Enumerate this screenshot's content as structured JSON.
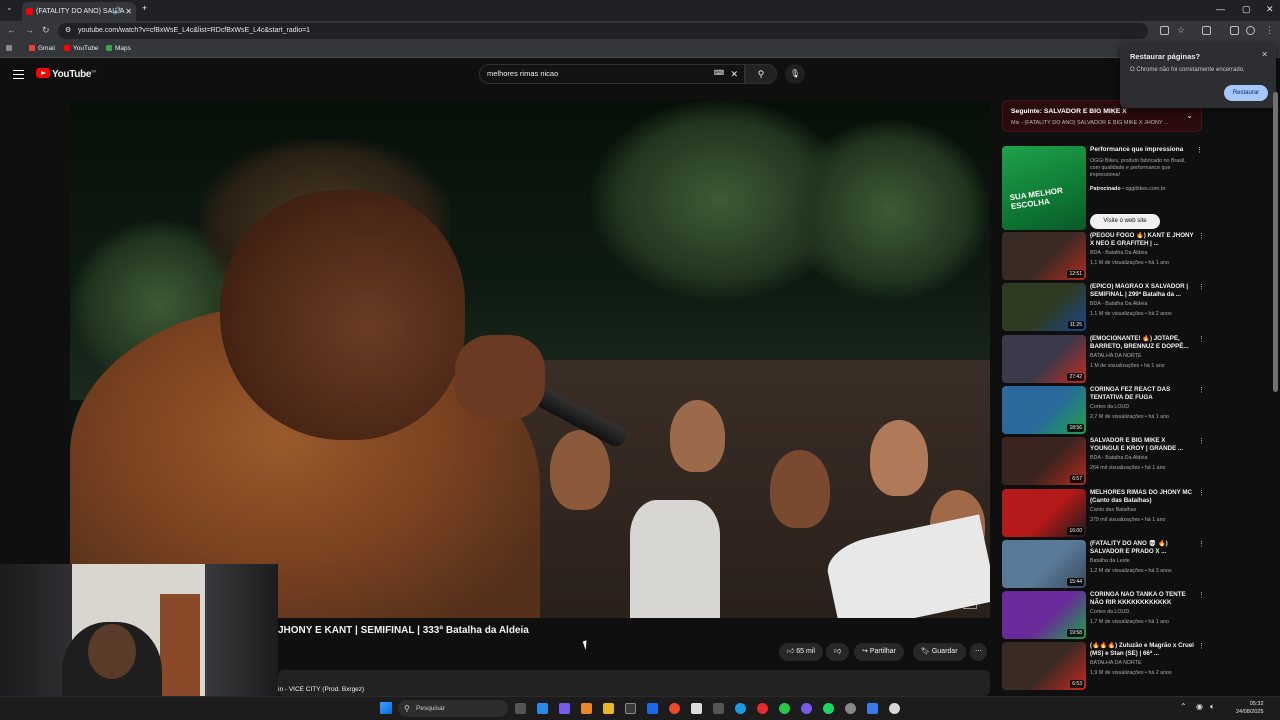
{
  "browser": {
    "tab_title": "(FATALITY DO ANO) SALVA",
    "url": "youtube.com/watch?v=cfBxWsE_L4c&list=RDcfBxWsE_L4c&start_radio=1",
    "bookmarks": [
      "Gmail",
      "YouTube",
      "Maps"
    ]
  },
  "youtube": {
    "logo": "YouTube",
    "logo_region": "BR",
    "search_value": "melhores rimas nicao"
  },
  "video": {
    "title": "JHONY E KANT | SEMIFINAL | 333ª Batalha da Aldeia",
    "likes": "65 mil",
    "share_label": "Partilhar",
    "save_label": "Guardar",
    "description_snippet": "in - VICE CITY (Prod. Bxrgez)"
  },
  "playlist": {
    "next_label": "Seguinte: SALVADOR E BIG MIKE X",
    "subtitle": "Mix - (FATALITY DO ANO) SALVADOR E BIG MIKE X JHONY ..."
  },
  "ad": {
    "title": "Performance que impressiona",
    "description": "OGGi Bikes, produto fabricado no Brasil, com qualidade e performance que impressiona!",
    "sponsored": "Patrocinado",
    "domain": "oggibikes.com.br",
    "thumb_text": "SUA MELHOR ESCOLHA",
    "cta": "Visite o web site"
  },
  "recommendations": [
    {
      "title": "(PEGOU FOGO 🔥) KANT E JHONY X NEO E GRAFITEH | ...",
      "channel": "BDA - Batalha Da Aldeia",
      "meta": "1,1 M de visualizações • há 1 ano",
      "duration": "12:51",
      "c1": "#3a2a24",
      "c2": "#b52a1c"
    },
    {
      "title": "(ÉPICO) MAGRÃO X SALVADOR | SEMIFINAL | 299ª Batalha da ...",
      "channel": "BDA - Batalha Da Aldeia",
      "meta": "1,1 M de visualizações • há 2 anos",
      "duration": "11:25",
      "c1": "#2e3a22",
      "c2": "#1a4a8a"
    },
    {
      "title": "(EMOCIONANTE! 🔥) JOTAPÊ, BARRETO, BRENNUZ E DOPPÊ...",
      "channel": "BATALHA DA NORTE",
      "meta": "1 M de visualizações • há 1 ano",
      "duration": "27:42",
      "c1": "#3a3a4a",
      "c2": "#c8281e"
    },
    {
      "title": "CORINGA FEZ REACT DAS TENTATIVA DE FUGA",
      "channel": "Cortes da LOUD",
      "meta": "2,7 M de visualizações • há 1 ano",
      "duration": "18:56",
      "c1": "#2a6a9a",
      "c2": "#1ea24a"
    },
    {
      "title": "SALVADOR E BIG MIKE X YOUNGUI E KROY | GRANDE ...",
      "channel": "BDA - Batalha Da Aldeia",
      "meta": "264 mil visualizações • há 1 ano",
      "duration": "6:57",
      "c1": "#3a2420",
      "c2": "#b52a1c"
    },
    {
      "title": "MELHORES RIMAS DO JHONY MC (Canto das Batalhas)",
      "channel": "Canto das Batalhas",
      "meta": "379 mil visualizações • há 1 ano",
      "duration": "16:00",
      "c1": "#b51a1a",
      "c2": "#1a1a1a"
    },
    {
      "title": "(FATALITY DO ANO 💀 🔥) SALVADOR E PRADO X ...",
      "channel": "Batalha da Leste",
      "meta": "1,2 M de visualizações • há 3 anos",
      "duration": "15:44",
      "c1": "#5a7a9a",
      "c2": "#3a4a5a"
    },
    {
      "title": "CORINGA NÃO TANKA O TENTE NÃO RIR KKKKKKKKKKKK",
      "channel": "Cortes da LOUD",
      "meta": "1,7 M de visualizações • há 1 ano",
      "duration": "19:58",
      "c1": "#6a2a9a",
      "c2": "#1ea24a"
    },
    {
      "title": "(🔥🔥🔥) Zuluzão e Magrão x Cruel (MS) e Stan (SE) | 66ª ...",
      "channel": "BATALHA DA NORTE",
      "meta": "1,9 M de visualizações • há 2 anos",
      "duration": "6:53",
      "c1": "#3a2a24",
      "c2": "#c8281e"
    }
  ],
  "restore_popup": {
    "title": "Restaurar páginas?",
    "message": "O Chrome não foi corretamente encerrado.",
    "button": "Restaurar"
  },
  "taskbar": {
    "search_placeholder": "Pesquisar",
    "time": "05:32",
    "date": "24/08/2025"
  },
  "colors": {
    "youtube_red": "#ff0000",
    "background": "#0f0f0f",
    "restore_button": "#a8c7fa"
  }
}
